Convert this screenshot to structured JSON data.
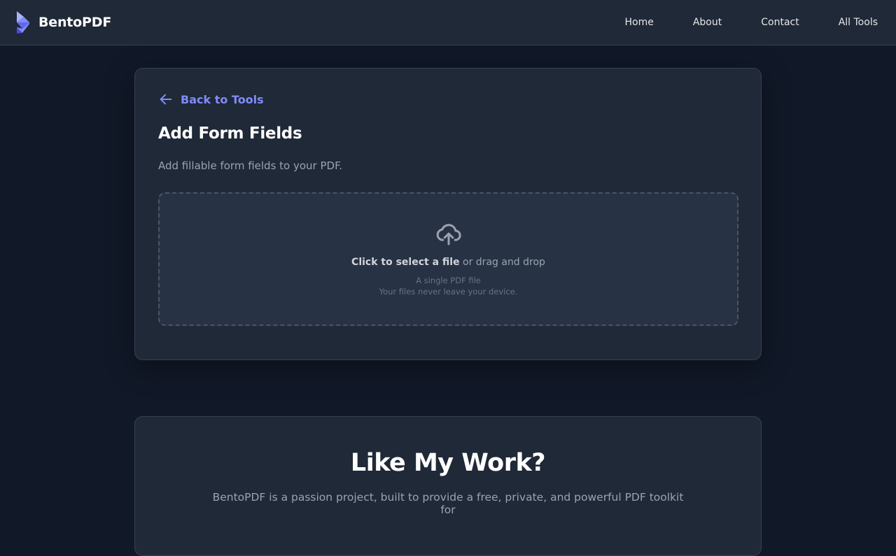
{
  "header": {
    "brand_name": "BentoPDF",
    "logo_icon": "bento-logo-icon",
    "nav": [
      {
        "label": "Home"
      },
      {
        "label": "About"
      },
      {
        "label": "Contact"
      },
      {
        "label": "All Tools"
      }
    ]
  },
  "tool": {
    "back_label": "Back to Tools",
    "back_icon": "arrow-left-icon",
    "title": "Add Form Fields",
    "description": "Add fillable form fields to your PDF."
  },
  "upload": {
    "icon": "cloud-upload-icon",
    "click_text": "Click to select a file",
    "drag_text": " or drag and drop",
    "file_hint": "A single PDF file",
    "privacy_note": "Your files never leave your device."
  },
  "support": {
    "title": "Like My Work?",
    "text": "BentoPDF is a passion project, built to provide a free, private, and powerful PDF toolkit for"
  },
  "colors": {
    "background": "#111827",
    "surface": "#1f2937",
    "accent": "#818cf8",
    "logo_primary": "#818cf8",
    "logo_secondary": "#6366f1",
    "border": "#374151"
  }
}
